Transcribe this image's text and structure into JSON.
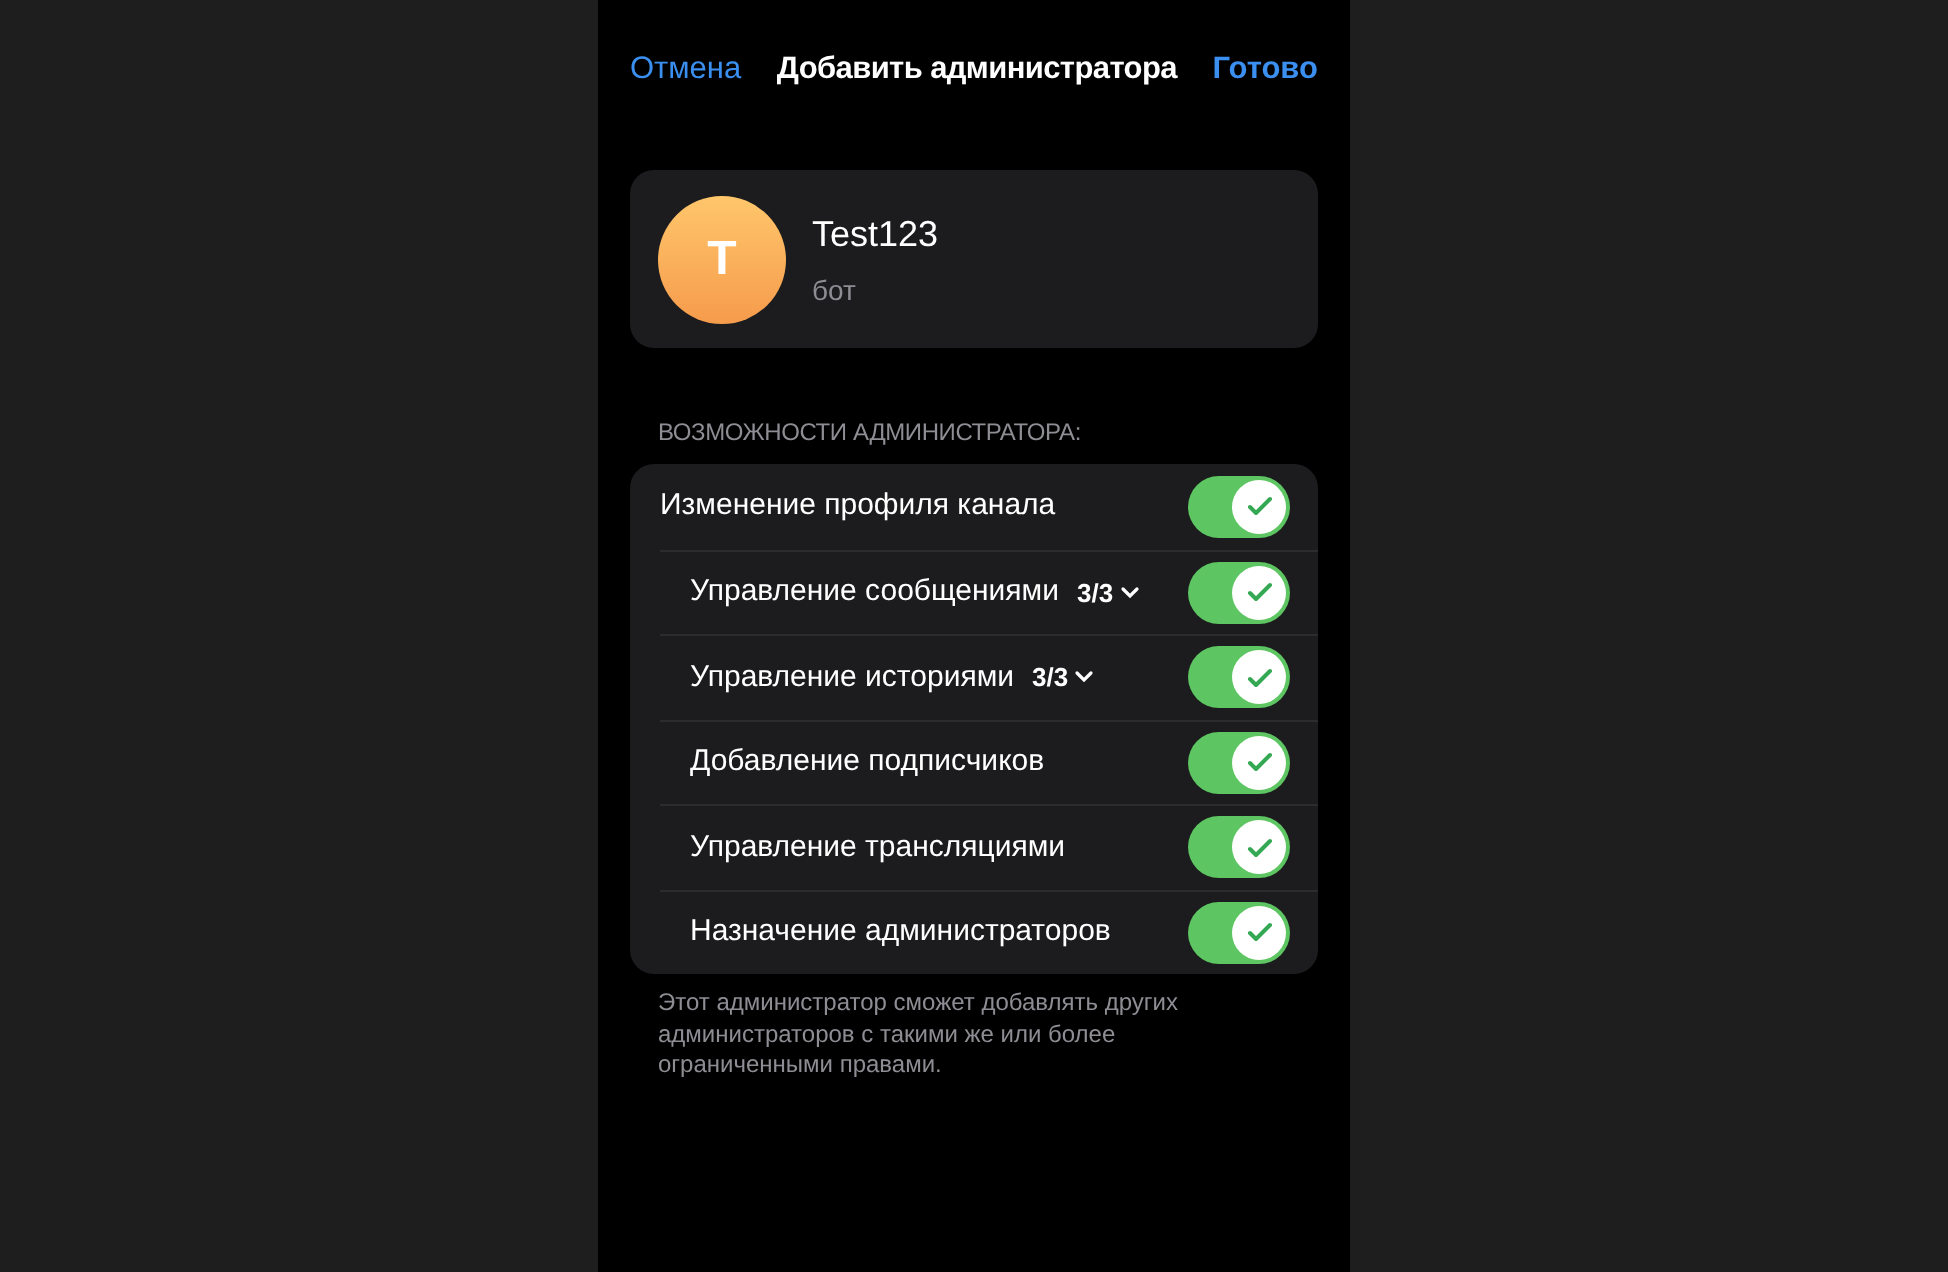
{
  "nav_bar": {
    "cancel": "Отмена",
    "title": "Добавить администратора",
    "done": "Готово"
  },
  "profile": {
    "avatar_letter": "T",
    "name": "Test123",
    "subtitle": "бот"
  },
  "section": {
    "header": "ВОЗМОЖНОСТИ АДМИНИСТРАТОРА:",
    "rights": [
      {
        "label": "Изменение профиля канала",
        "on": true
      },
      {
        "label": "Управление сообщениями",
        "count": "3/3",
        "on": true
      },
      {
        "label": "Управление историями",
        "count": "3/3",
        "on": true
      },
      {
        "label": "Добавление подписчиков",
        "on": true
      },
      {
        "label": "Управление трансляциями",
        "on": true
      },
      {
        "label": "Назначение администраторов",
        "on": true
      }
    ],
    "footer": "Этот администратор сможет добавлять других администраторов с такими же или более ограниченными правами."
  }
}
